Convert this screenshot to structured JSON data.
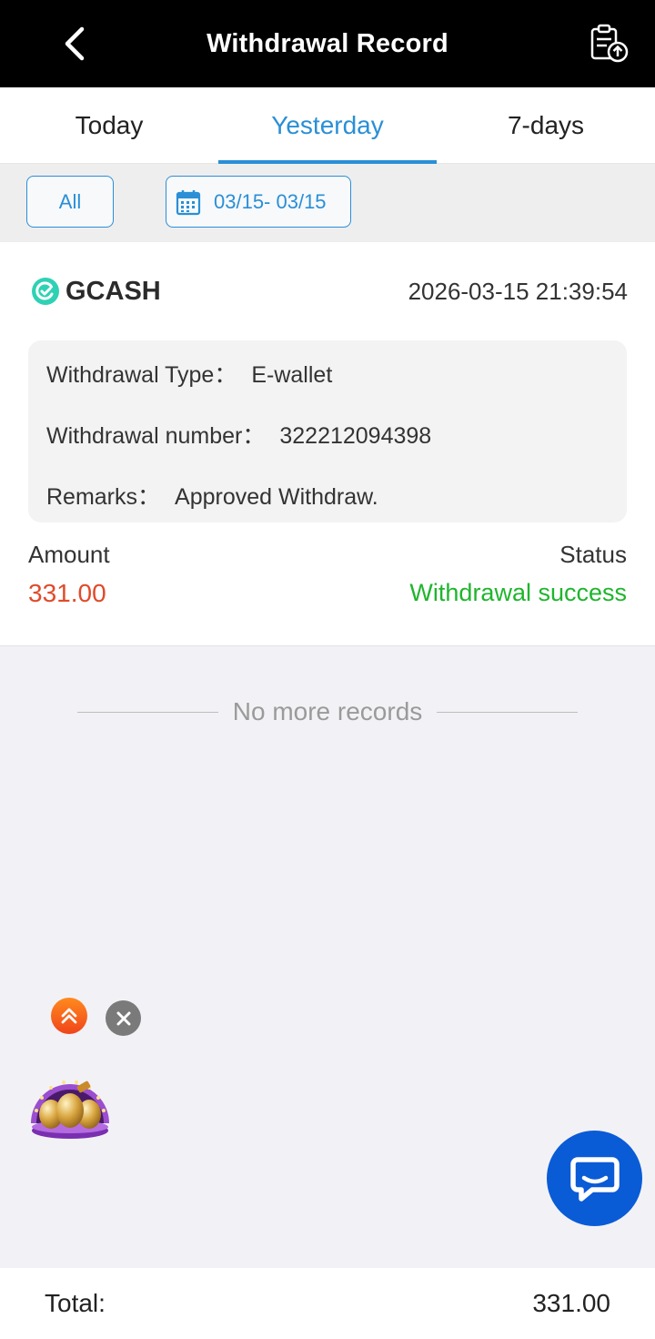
{
  "header": {
    "title": "Withdrawal Record",
    "back_icon": "chevron-left-icon",
    "records_icon": "clipboard-upload-icon"
  },
  "tabs": [
    {
      "label": "Today",
      "active": false
    },
    {
      "label": "Yesterday",
      "active": true
    },
    {
      "label": "7-days",
      "active": false
    }
  ],
  "filters": {
    "all_label": "All",
    "date_range": "03/15- 03/15",
    "calendar_icon": "calendar-icon"
  },
  "record": {
    "method": "GCASH",
    "datetime": "2026-03-15 21:39:54",
    "type_label": "Withdrawal Type：",
    "type_value": "E-wallet",
    "number_label": "Withdrawal number：",
    "number_value": "322212094398",
    "remarks_label": "Remarks：",
    "remarks_value": "Approved Withdraw.",
    "amount_label": "Amount",
    "amount_value": "331.00",
    "status_label": "Status",
    "status_value": "Withdrawal success"
  },
  "list_end_text": "No more records",
  "footer": {
    "total_label": "Total:",
    "total_value": "331.00"
  },
  "colors": {
    "accent": "#2a8fd6",
    "amount": "#e04a2a",
    "success": "#1fb52c",
    "chat": "#0a5bd6"
  }
}
